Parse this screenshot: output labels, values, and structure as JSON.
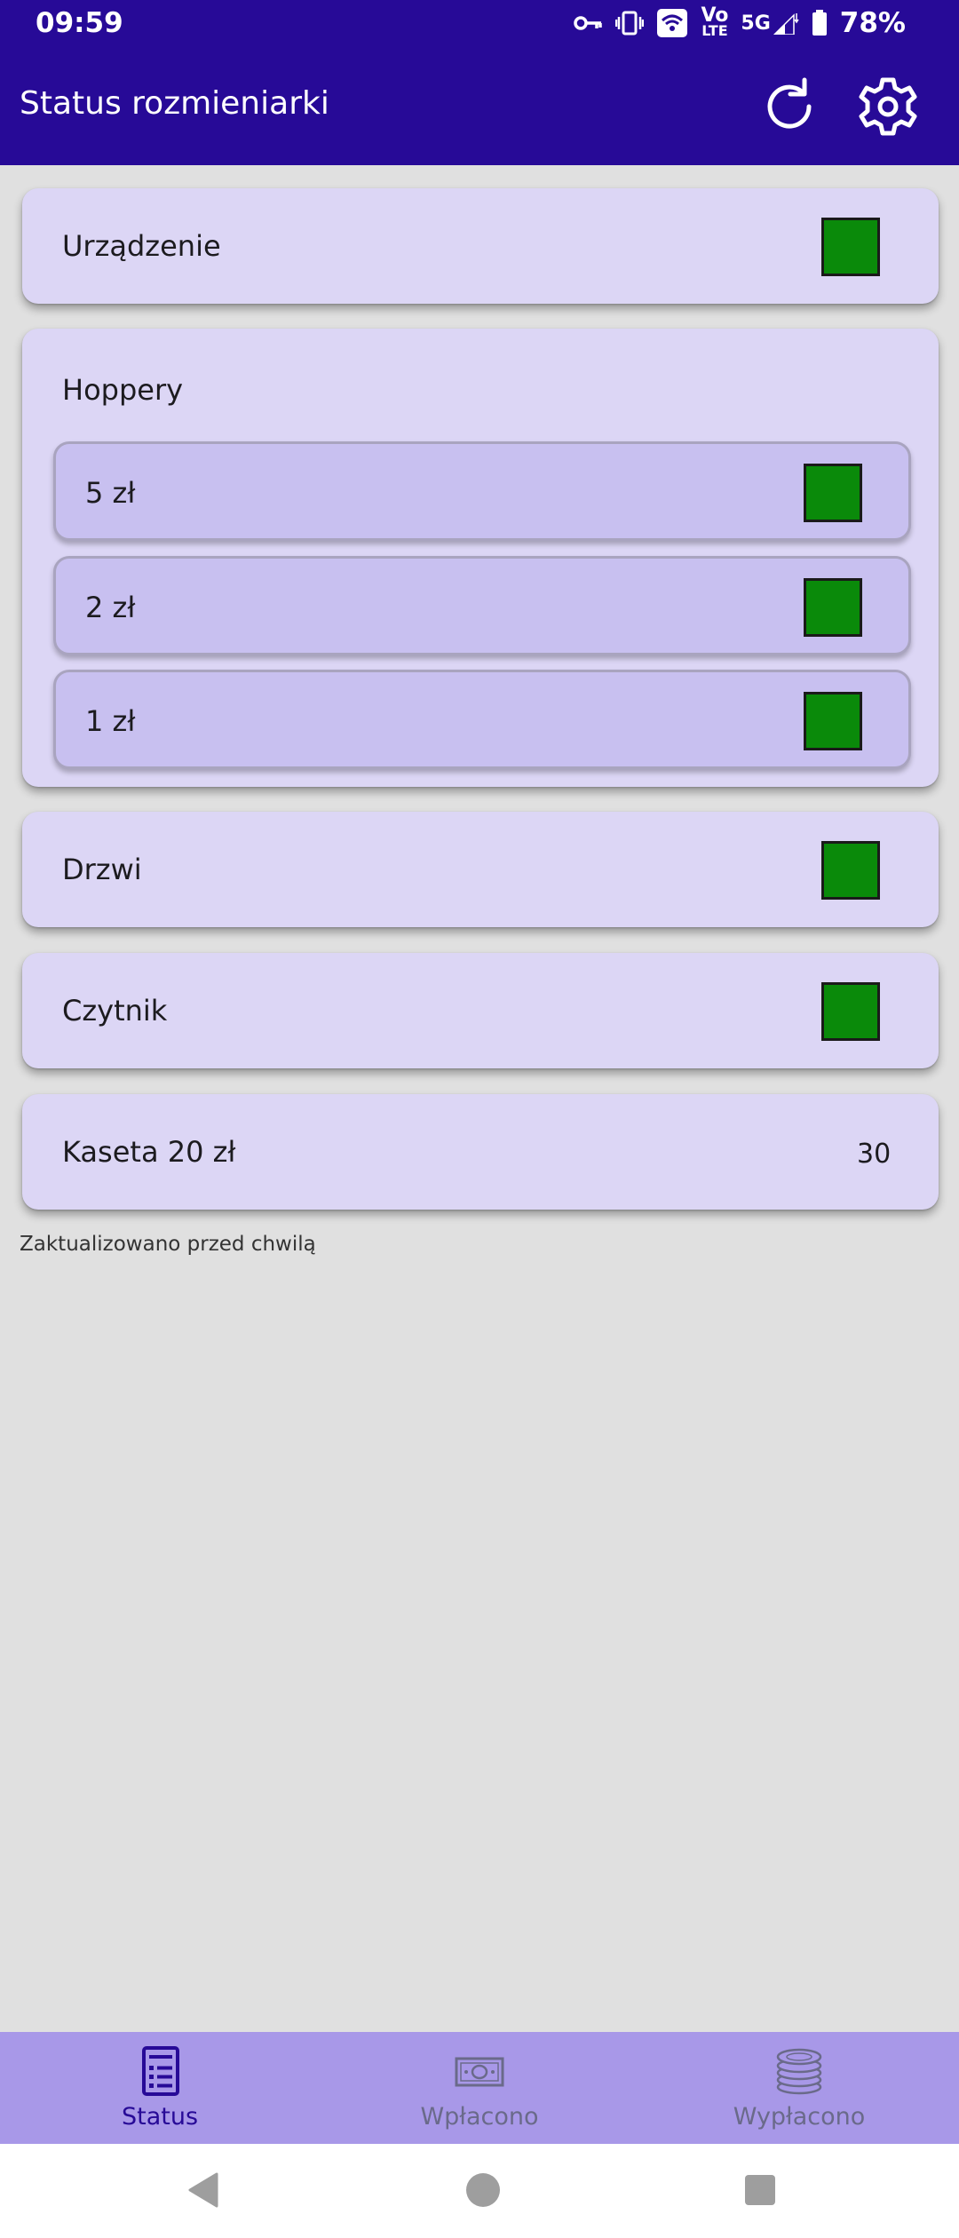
{
  "status_bar": {
    "time": "09:59",
    "network": "5G",
    "volte_top": "Vo",
    "volte_bottom": "LTE",
    "battery": "78%",
    "icons": [
      "vpn-key-icon",
      "vibrate-icon",
      "wifi-icon",
      "volte-icon",
      "signal-icon",
      "battery-icon"
    ]
  },
  "app_bar": {
    "title": "Status rozmieniarki",
    "actions": [
      "refresh-icon",
      "settings-gear-icon"
    ]
  },
  "status": {
    "device": {
      "label": "Urządzenie",
      "ok": true
    },
    "hoppers": {
      "label": "Hoppery",
      "items": [
        {
          "label": "5 zł",
          "ok": true
        },
        {
          "label": "2 zł",
          "ok": true
        },
        {
          "label": "1 zł",
          "ok": true
        }
      ]
    },
    "door": {
      "label": "Drzwi",
      "ok": true
    },
    "reader": {
      "label": "Czytnik",
      "ok": true
    },
    "cassette": {
      "label": "Kaseta 20 zł",
      "value": "30"
    },
    "updated": "Zaktualizowano przed chwilą"
  },
  "bottom_nav": {
    "items": [
      {
        "label": "Status",
        "icon": "status-list-icon",
        "active": true
      },
      {
        "label": "Wpłacono",
        "icon": "banknote-icon",
        "active": false
      },
      {
        "label": "Wypłacono",
        "icon": "coins-icon",
        "active": false
      }
    ]
  },
  "colors": {
    "primary": "#270a97",
    "card": "#dcd6f5",
    "sub_card": "#c8c0f0",
    "status_ok": "#0a8a0a",
    "nav_bg": "#a898e8",
    "background": "#e0e0e0"
  }
}
